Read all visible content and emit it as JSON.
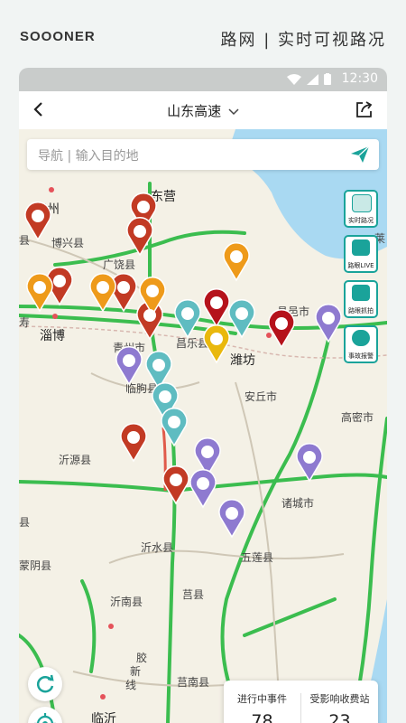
{
  "brand": "SOOONER",
  "tagline": "路网 | 实时可视路况",
  "status": {
    "time": "12:30"
  },
  "nav": {
    "title": "山东高速"
  },
  "search": {
    "placeholder": "导航 | 输入目的地"
  },
  "side_buttons": [
    {
      "label": "实时路况",
      "icon": "traffic-light-icon"
    },
    {
      "label": "路眼LIVE",
      "icon": "live-camera-icon"
    },
    {
      "label": "路眼抓拍",
      "icon": "camera-icon"
    },
    {
      "label": "事故报警",
      "icon": "police-icon"
    }
  ],
  "stats": {
    "ongoing_label": "进行中事件",
    "ongoing_value": "78",
    "affected_label": "受影响收费站",
    "affected_value": "23"
  },
  "cities": [
    {
      "name": "滨州"
    },
    {
      "name": "东营"
    },
    {
      "name": "博兴县"
    },
    {
      "name": "广饶县"
    },
    {
      "name": "淄博"
    },
    {
      "name": "青州市"
    },
    {
      "name": "昌乐县"
    },
    {
      "name": "潍坊"
    },
    {
      "name": "昌邑市"
    },
    {
      "name": "安丘市"
    },
    {
      "name": "高密市"
    },
    {
      "name": "临朐县"
    },
    {
      "name": "沂源县"
    },
    {
      "name": "诸城市"
    },
    {
      "name": "沂水县"
    },
    {
      "name": "五莲县"
    },
    {
      "name": "蒙阴县"
    },
    {
      "name": "沂南县"
    },
    {
      "name": "莒县"
    },
    {
      "name": "莒南县"
    },
    {
      "name": "临沂"
    },
    {
      "name": "县"
    },
    {
      "name": "寿"
    },
    {
      "name": "莱"
    },
    {
      "name": "县"
    }
  ],
  "highway_labels": [
    {
      "name": "胶"
    },
    {
      "name": "新"
    },
    {
      "name": "线"
    }
  ],
  "colors": {
    "accent": "#1aa39a",
    "road_green": "#3bbd4f",
    "incident_red": "#c23a24",
    "service_purple": "#8e7ad0",
    "warning_orange": "#ee9a1a",
    "construction_teal": "#5fbcc1"
  }
}
